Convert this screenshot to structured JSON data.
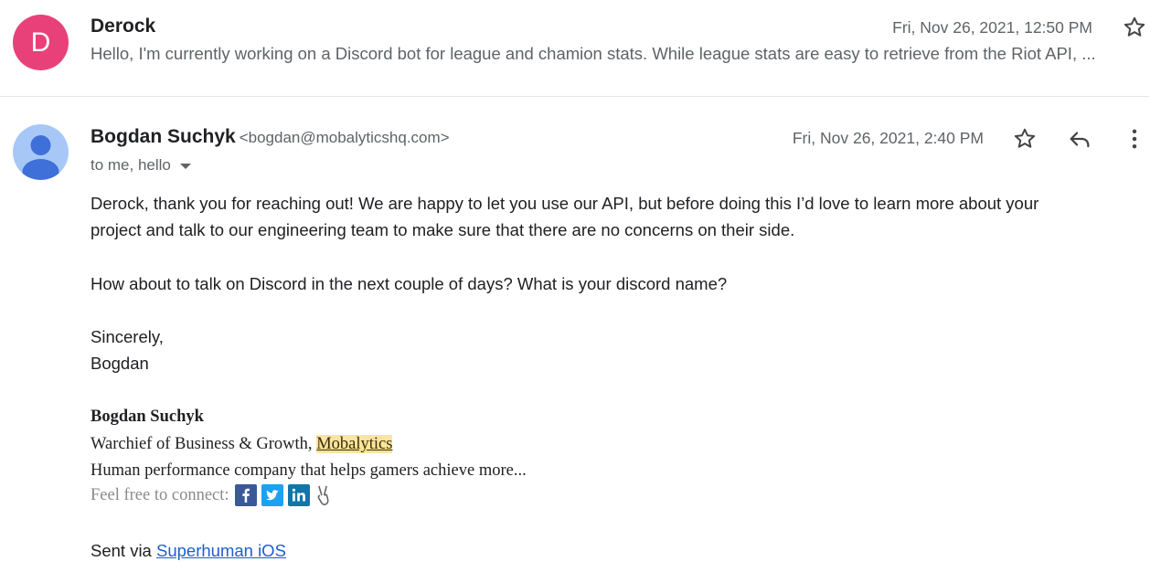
{
  "collapsed_message": {
    "avatar_letter": "D",
    "sender": "Derock",
    "date": "Fri, Nov 26, 2021, 12:50 PM",
    "snippet": "Hello, I'm currently working on a Discord bot for league and chamion stats. While league stats are easy to retrieve from the Riot API, ..."
  },
  "expanded_message": {
    "sender_name": "Bogdan Suchyk",
    "sender_email": "<bogdan@mobalyticshq.com>",
    "recipients": "to me, hello",
    "date": "Fri, Nov 26, 2021, 2:40 PM",
    "body": {
      "paragraph1_line1": "Derock, thank you for reaching out! We are happy to let you use our API, but before doing this I’d love to learn more about your",
      "paragraph1_line2": "project and talk to our engineering team to make sure that there are no concerns on their side.",
      "paragraph2": "How about to talk on Discord in the next couple of days? What is your discord name?",
      "closing": "Sincerely,",
      "closing_name": "Bogdan"
    },
    "signature": {
      "name": "Bogdan Suchyk",
      "title_prefix": "Warchief of Business & Growth, ",
      "company_link": "Mobalytics",
      "tagline": "Human performance company that helps gamers achieve more...",
      "connect_label": "Feel free to connect:",
      "social_icons": [
        "facebook-icon",
        "twitter-icon",
        "linkedin-icon",
        "peace-hand-icon"
      ]
    },
    "sent_via_prefix": "Sent via ",
    "sent_via_link": "Superhuman iOS"
  },
  "colors": {
    "avatar_letter_bg": "#e8417a",
    "avatar_person_bg": "#a7c8f7",
    "link_highlight": "#fbe59a",
    "link_blue": "#1a5fd0"
  }
}
